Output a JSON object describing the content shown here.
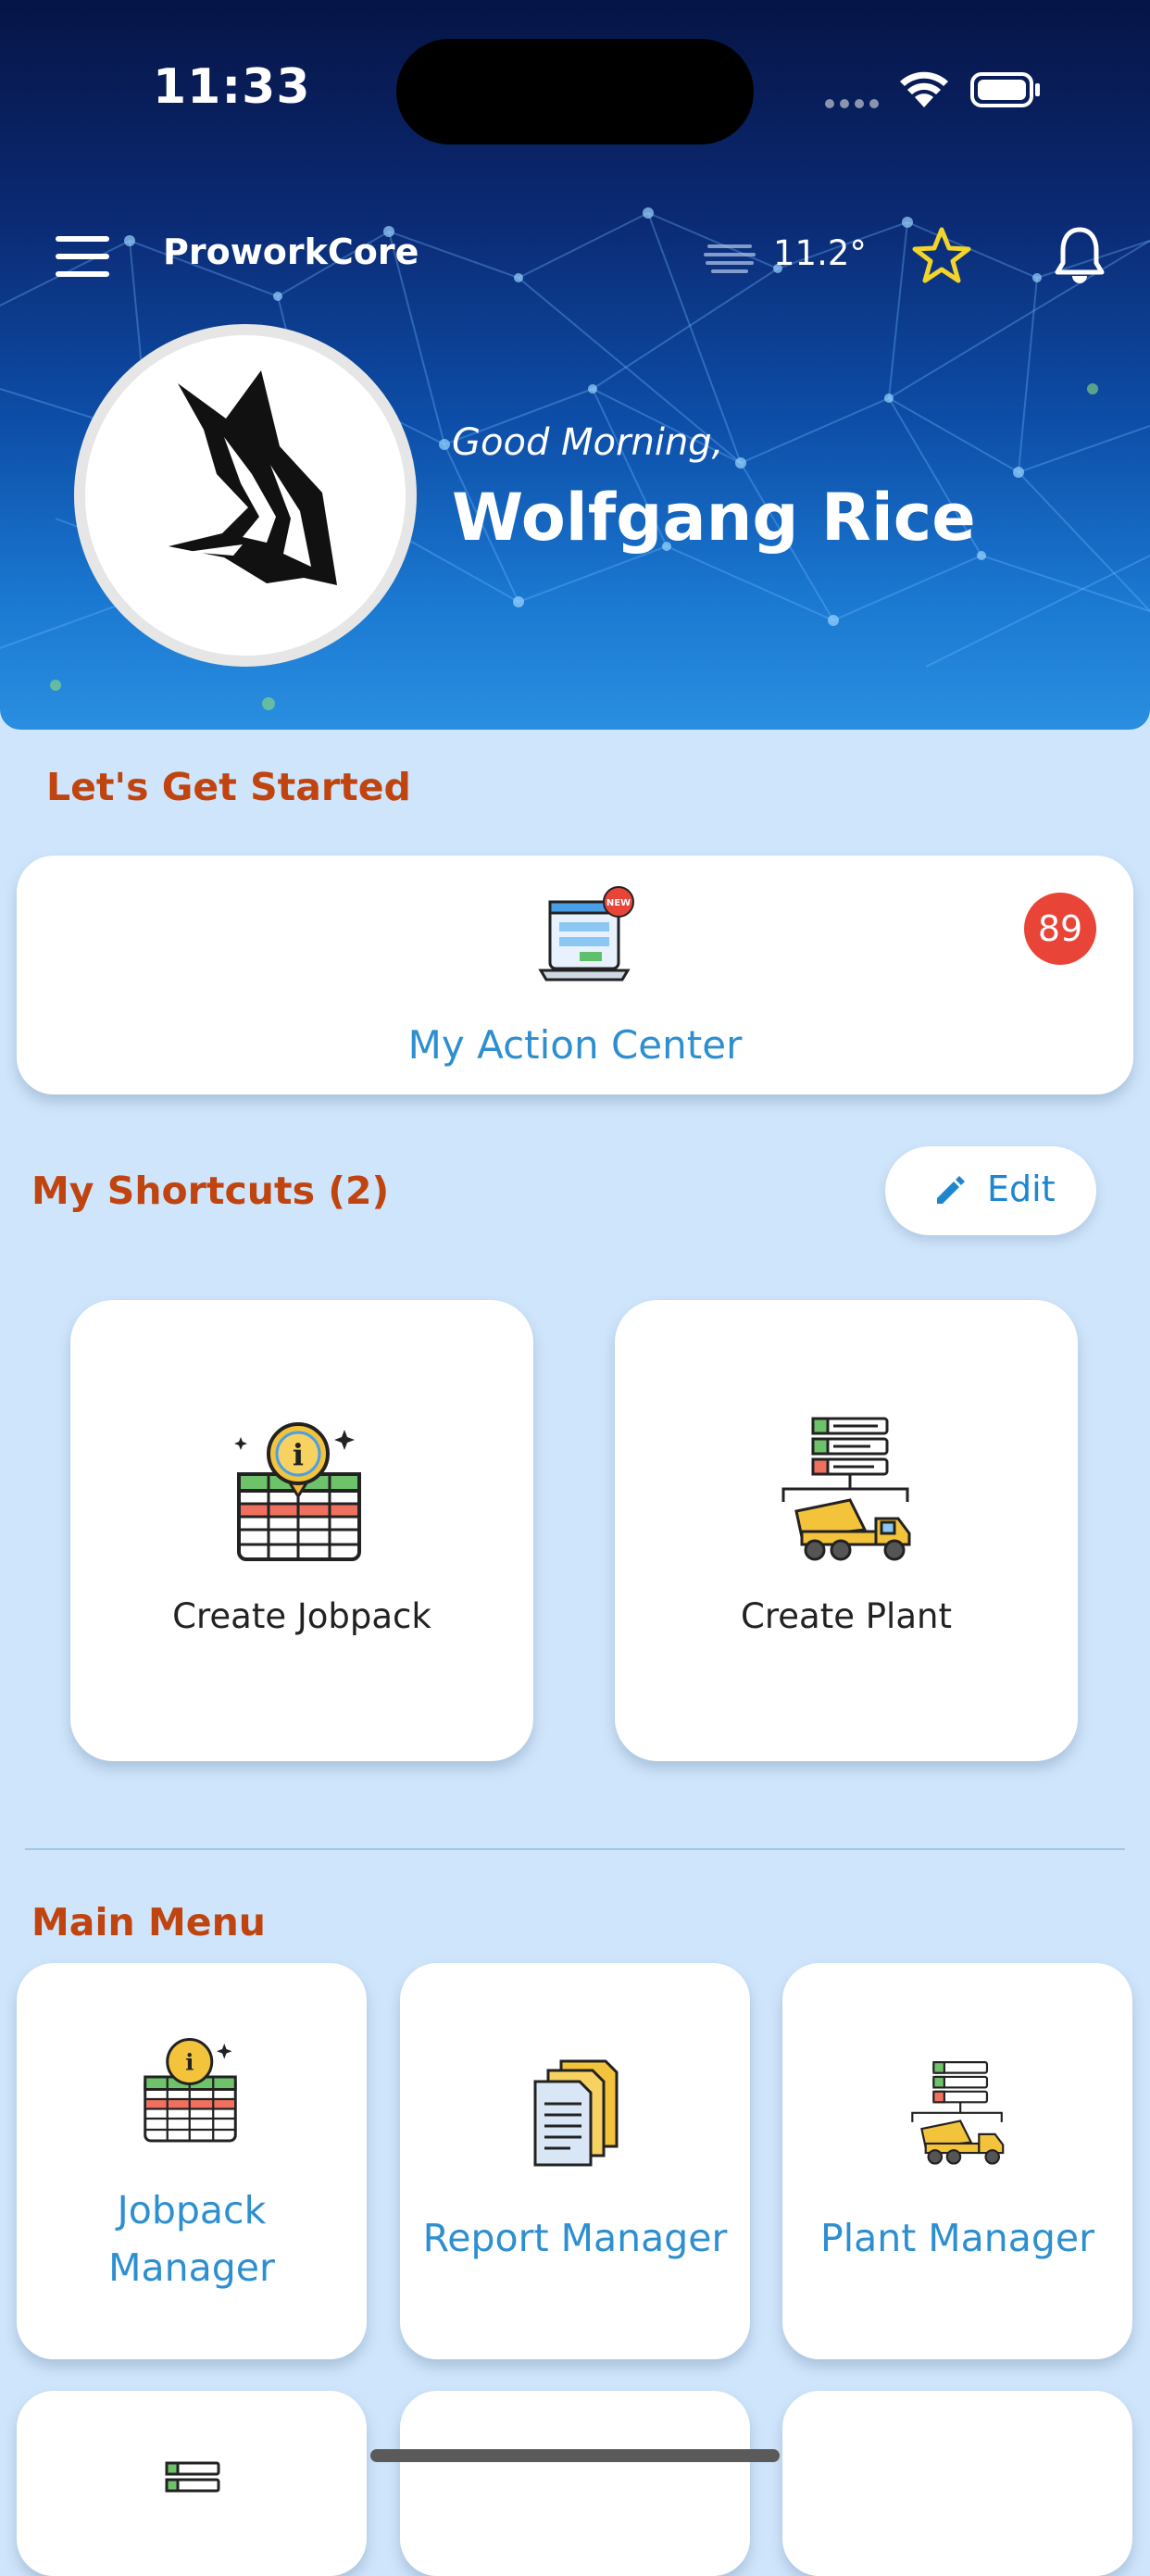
{
  "status_bar": {
    "time": "11:33"
  },
  "header": {
    "app_title": "ProworkCore",
    "temperature": "11.2°",
    "icons": [
      "menu-icon",
      "weather-icon",
      "star-icon",
      "bell-icon"
    ]
  },
  "profile": {
    "greeting": "Good Morning,",
    "name": "Wolfgang Rice"
  },
  "get_started": {
    "title": "Let's Get Started",
    "action_center": {
      "label": "My Action Center",
      "badge": "89"
    }
  },
  "shortcuts": {
    "title": "My Shortcuts (2)",
    "edit_label": "Edit",
    "items": [
      {
        "label": "Create Jobpack",
        "icon": "jobpack-icon"
      },
      {
        "label": "Create Plant",
        "icon": "plant-icon"
      }
    ]
  },
  "main_menu": {
    "title": "Main Menu",
    "items": [
      {
        "label_line1": "Jobpack",
        "label_line2": "Manager",
        "icon": "jobpack-icon"
      },
      {
        "label": "Report Manager",
        "icon": "report-icon"
      },
      {
        "label": "Plant Manager",
        "icon": "plant-icon"
      }
    ]
  },
  "colors": {
    "accent_orange": "#c0440f",
    "link_blue": "#2e8fd0",
    "badge_red": "#e84437",
    "background": "#cfe5fb"
  }
}
